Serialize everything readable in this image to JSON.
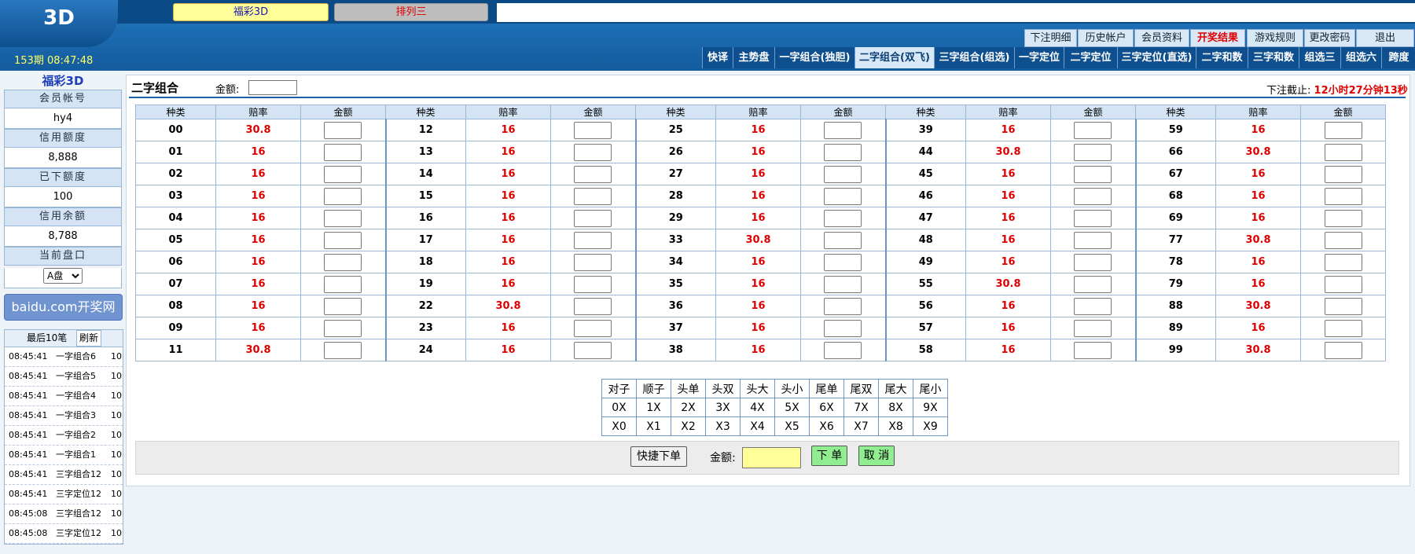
{
  "header": {
    "logo_text": "3D",
    "lottery_tabs": [
      "福彩3D",
      "排列三"
    ],
    "period": "153期 08:47:48",
    "top_links": [
      "下注明细",
      "历史帐户",
      "会员资料",
      "开奖结果",
      "游戏规则",
      "更改密码",
      "退出"
    ],
    "nav_tabs": [
      "快译",
      "主势盘",
      "一字组合(独胆)",
      "二字组合(双飞)",
      "三字组合(组选)",
      "一字定位",
      "二字定位",
      "三字定位(直选)",
      "二字和数",
      "三字和数",
      "组选三",
      "组选六",
      "跨度"
    ],
    "active_tab": "二字组合(双飞)"
  },
  "sidebar": {
    "title": "福彩3D",
    "rows": [
      {
        "label": "会员帐号",
        "value": "hy4"
      },
      {
        "label": "信用额度",
        "value": "8,888"
      },
      {
        "label": "已下额度",
        "value": "100"
      },
      {
        "label": "信用余额",
        "value": "8,788"
      }
    ],
    "pan_label": "当前盘口",
    "pan_selected": "A盘",
    "kaijiang_link": "baidu.com开奖网",
    "recent_title": "最后10笔",
    "refresh_label": "刷新",
    "recent": [
      {
        "time": "08:45:41",
        "item": "一字组合6",
        "amount": "10"
      },
      {
        "time": "08:45:41",
        "item": "一字组合5",
        "amount": "10"
      },
      {
        "time": "08:45:41",
        "item": "一字组合4",
        "amount": "10"
      },
      {
        "time": "08:45:41",
        "item": "一字组合3",
        "amount": "10"
      },
      {
        "time": "08:45:41",
        "item": "一字组合2",
        "amount": "10"
      },
      {
        "time": "08:45:41",
        "item": "一字组合1",
        "amount": "10"
      },
      {
        "time": "08:45:41",
        "item": "三字组合12",
        "amount": "10"
      },
      {
        "time": "08:45:41",
        "item": "三字定位12",
        "amount": "10"
      },
      {
        "time": "08:45:08",
        "item": "三字组合12",
        "amount": "10"
      },
      {
        "time": "08:45:08",
        "item": "三字定位12",
        "amount": "10"
      }
    ]
  },
  "main": {
    "title": "二字组合",
    "amount_label": "金额:",
    "deadline_label": "下注截止:",
    "deadline_value": "12小时27分钟13秒",
    "col_headers": [
      "种类",
      "赔率",
      "金额"
    ],
    "groups": [
      [
        [
          "00",
          "30.8"
        ],
        [
          "01",
          "16"
        ],
        [
          "02",
          "16"
        ],
        [
          "03",
          "16"
        ],
        [
          "04",
          "16"
        ],
        [
          "05",
          "16"
        ],
        [
          "06",
          "16"
        ],
        [
          "07",
          "16"
        ],
        [
          "08",
          "16"
        ],
        [
          "09",
          "16"
        ],
        [
          "11",
          "30.8"
        ]
      ],
      [
        [
          "12",
          "16"
        ],
        [
          "13",
          "16"
        ],
        [
          "14",
          "16"
        ],
        [
          "15",
          "16"
        ],
        [
          "16",
          "16"
        ],
        [
          "17",
          "16"
        ],
        [
          "18",
          "16"
        ],
        [
          "19",
          "16"
        ],
        [
          "22",
          "30.8"
        ],
        [
          "23",
          "16"
        ],
        [
          "24",
          "16"
        ]
      ],
      [
        [
          "25",
          "16"
        ],
        [
          "26",
          "16"
        ],
        [
          "27",
          "16"
        ],
        [
          "28",
          "16"
        ],
        [
          "29",
          "16"
        ],
        [
          "33",
          "30.8"
        ],
        [
          "34",
          "16"
        ],
        [
          "35",
          "16"
        ],
        [
          "36",
          "16"
        ],
        [
          "37",
          "16"
        ],
        [
          "38",
          "16"
        ]
      ],
      [
        [
          "39",
          "16"
        ],
        [
          "44",
          "30.8"
        ],
        [
          "45",
          "16"
        ],
        [
          "46",
          "16"
        ],
        [
          "47",
          "16"
        ],
        [
          "48",
          "16"
        ],
        [
          "49",
          "16"
        ],
        [
          "55",
          "30.8"
        ],
        [
          "56",
          "16"
        ],
        [
          "57",
          "16"
        ],
        [
          "58",
          "16"
        ]
      ],
      [
        [
          "59",
          "16"
        ],
        [
          "66",
          "30.8"
        ],
        [
          "67",
          "16"
        ],
        [
          "68",
          "16"
        ],
        [
          "69",
          "16"
        ],
        [
          "77",
          "30.8"
        ],
        [
          "78",
          "16"
        ],
        [
          "79",
          "16"
        ],
        [
          "88",
          "30.8"
        ],
        [
          "89",
          "16"
        ],
        [
          "99",
          "30.8"
        ]
      ]
    ],
    "quick_rows": [
      [
        "对子",
        "顺子",
        "头单",
        "头双",
        "头大",
        "头小",
        "尾单",
        "尾双",
        "尾大",
        "尾小"
      ],
      [
        "0X",
        "1X",
        "2X",
        "3X",
        "4X",
        "5X",
        "6X",
        "7X",
        "8X",
        "9X"
      ],
      [
        "X0",
        "X1",
        "X2",
        "X3",
        "X4",
        "X5",
        "X6",
        "X7",
        "X8",
        "X9"
      ]
    ],
    "quick_bet_label": "快捷下单",
    "foot_amount_label": "金额:",
    "submit_label": "下 单",
    "cancel_label": "取 消"
  },
  "colors": {
    "odds_red": "#e00000",
    "header_blue": "#0c4f8c",
    "amount_yellow": "#ffff99",
    "button_green": "#90ee90"
  }
}
